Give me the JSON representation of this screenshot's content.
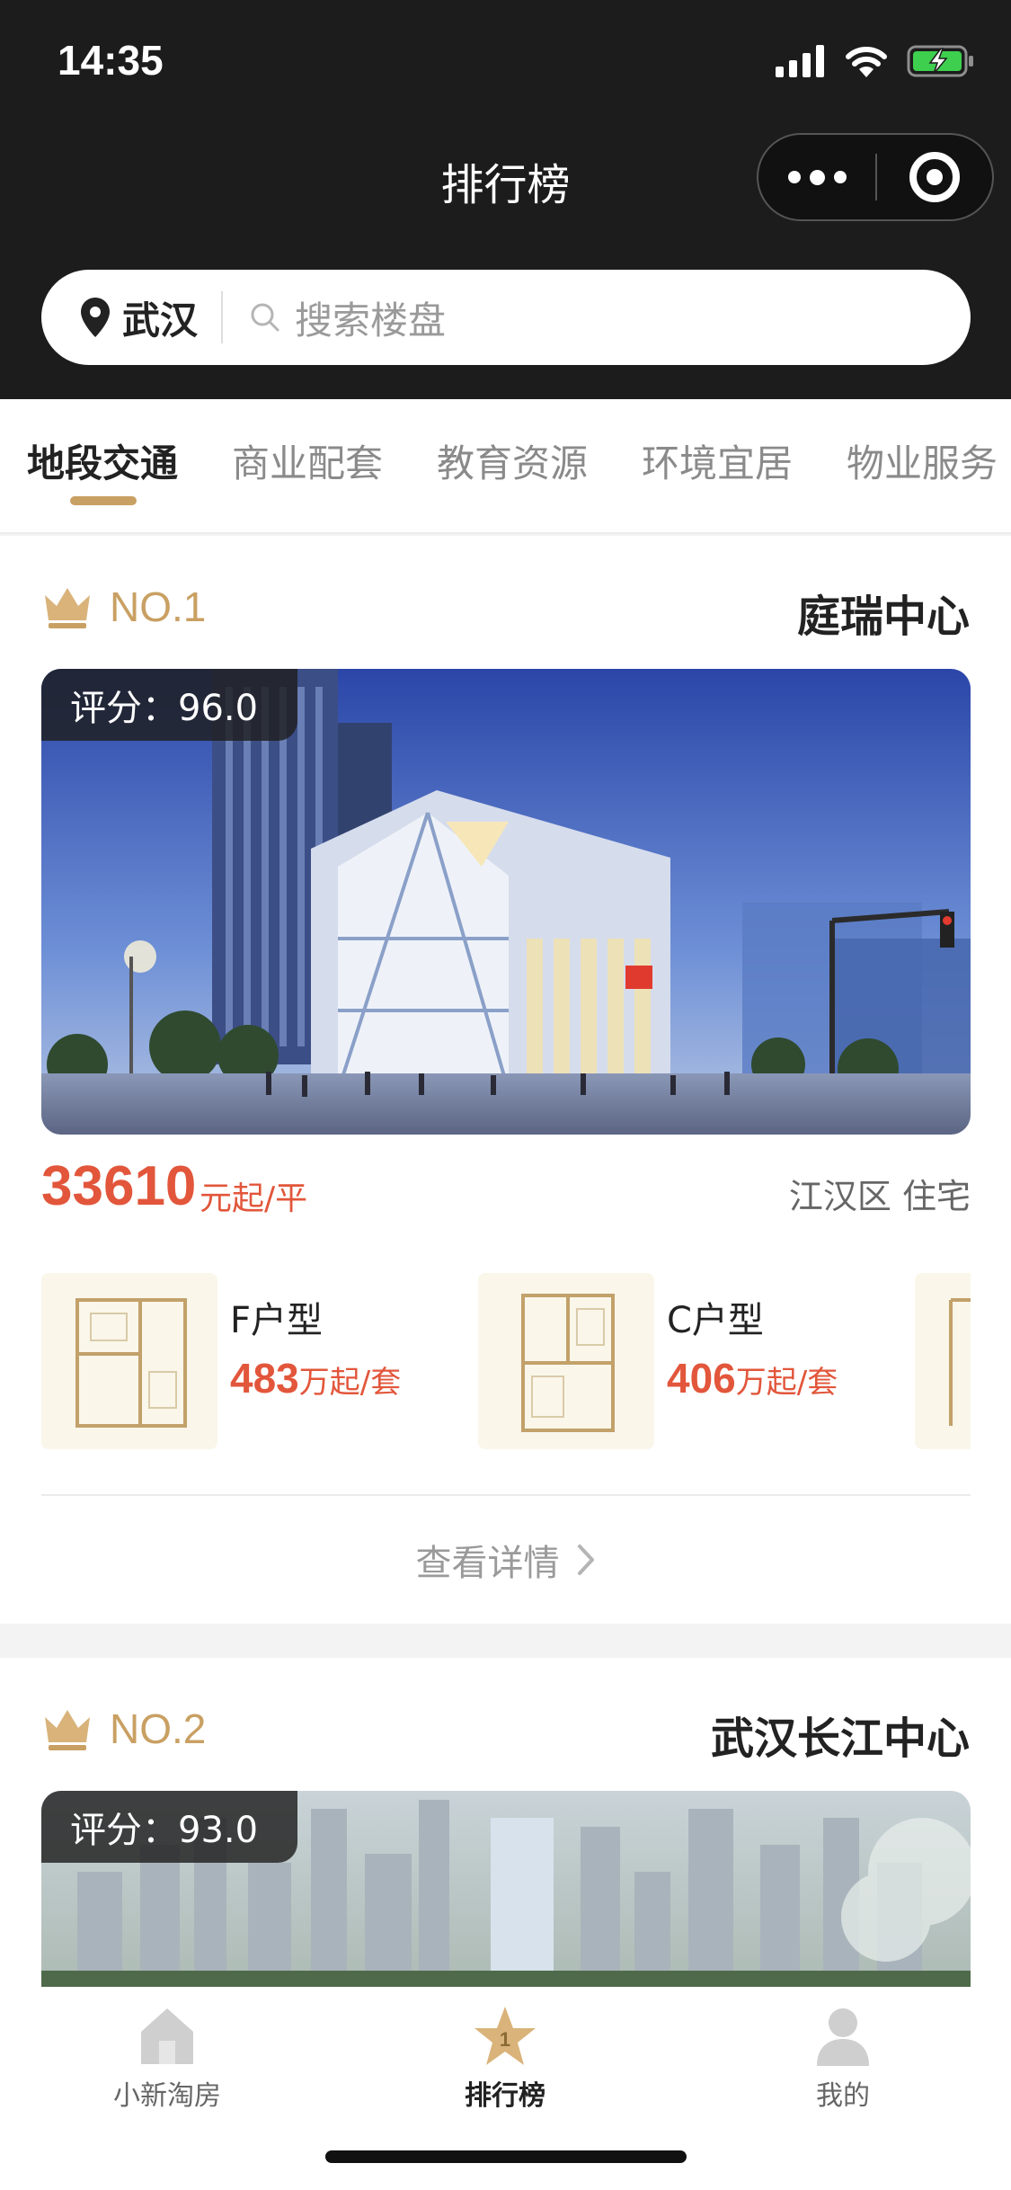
{
  "status_bar": {
    "time": "14:35"
  },
  "nav": {
    "title": "排行榜"
  },
  "search": {
    "city": "武汉",
    "placeholder": "搜索楼盘"
  },
  "tabs": [
    {
      "label": "地段交通",
      "active": true
    },
    {
      "label": "商业配套",
      "active": false
    },
    {
      "label": "教育资源",
      "active": false
    },
    {
      "label": "环境宜居",
      "active": false
    },
    {
      "label": "物业服务",
      "active": false
    }
  ],
  "listings": [
    {
      "rank": "NO.1",
      "name": "庭瑞中心",
      "score_text": "评分：96.0",
      "price": "33610",
      "price_unit": "元起/平",
      "district": "江汉区  住宅",
      "layouts": [
        {
          "name": "F户型",
          "price": "483",
          "unit": "万起/套"
        },
        {
          "name": "C户型",
          "price": "406",
          "unit": "万起/套"
        }
      ],
      "detail_label": "查看详情"
    },
    {
      "rank": "NO.2",
      "name": "武汉长江中心",
      "score_text": "评分：93.0"
    }
  ],
  "tabbar": [
    {
      "label": "小新淘房",
      "icon": "house-icon"
    },
    {
      "label": "排行榜",
      "icon": "star-icon",
      "active": true
    },
    {
      "label": "我的",
      "icon": "person-icon"
    }
  ],
  "colors": {
    "accent_gold": "#c9a063",
    "price_red": "#e2563b",
    "header_bg": "#1c1c1c"
  }
}
